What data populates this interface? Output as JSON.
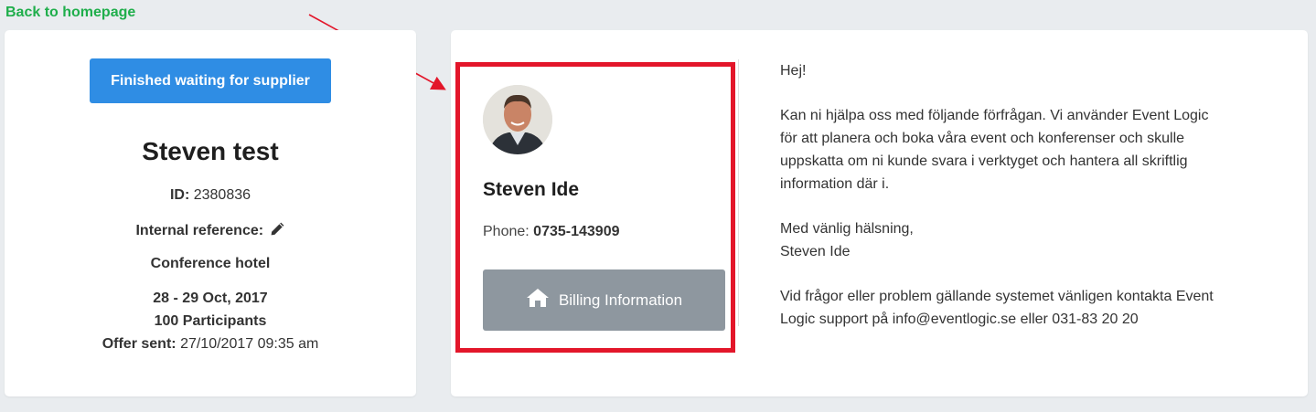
{
  "nav": {
    "back_label": "Back to homepage"
  },
  "event": {
    "action_button": "Finished waiting for supplier",
    "title": "Steven test",
    "id_label": "ID:",
    "id_value": "2380836",
    "internal_ref_label": "Internal reference:",
    "type": "Conference hotel",
    "dates": "28 - 29 Oct, 2017",
    "participants": "100 Participants",
    "offer_sent_label": "Offer sent:",
    "offer_sent_value": "27/10/2017 09:35 am"
  },
  "contact": {
    "name": "Steven Ide",
    "phone_label": "Phone:",
    "phone_value": "0735-143909",
    "billing_button": "Billing Information"
  },
  "message": {
    "greeting": "Hej!",
    "body_line1": "Kan ni hjälpa oss med följande förfrågan. Vi använder Event Logic",
    "body_line2": "för att planera och boka våra event och konferenser och skulle",
    "body_line3": "uppskatta om ni kunde svara i verktyget och hantera all skriftlig",
    "body_line4": "information där i.",
    "signoff": "Med vänlig hälsning,",
    "signature": "Steven Ide",
    "support_line1": "Vid frågor eller problem gällande systemet vänligen kontakta Event",
    "support_line2": "Logic support på info@eventlogic.se eller 031-83 20 20"
  },
  "colors": {
    "link_green": "#1fae4b",
    "primary_blue": "#2f8de4",
    "highlight_red": "#e3162a",
    "billing_gray": "#8e979f"
  },
  "icons": {
    "edit": "pencil-icon",
    "billing": "home-icon",
    "annotation": "arrow-annotation"
  }
}
